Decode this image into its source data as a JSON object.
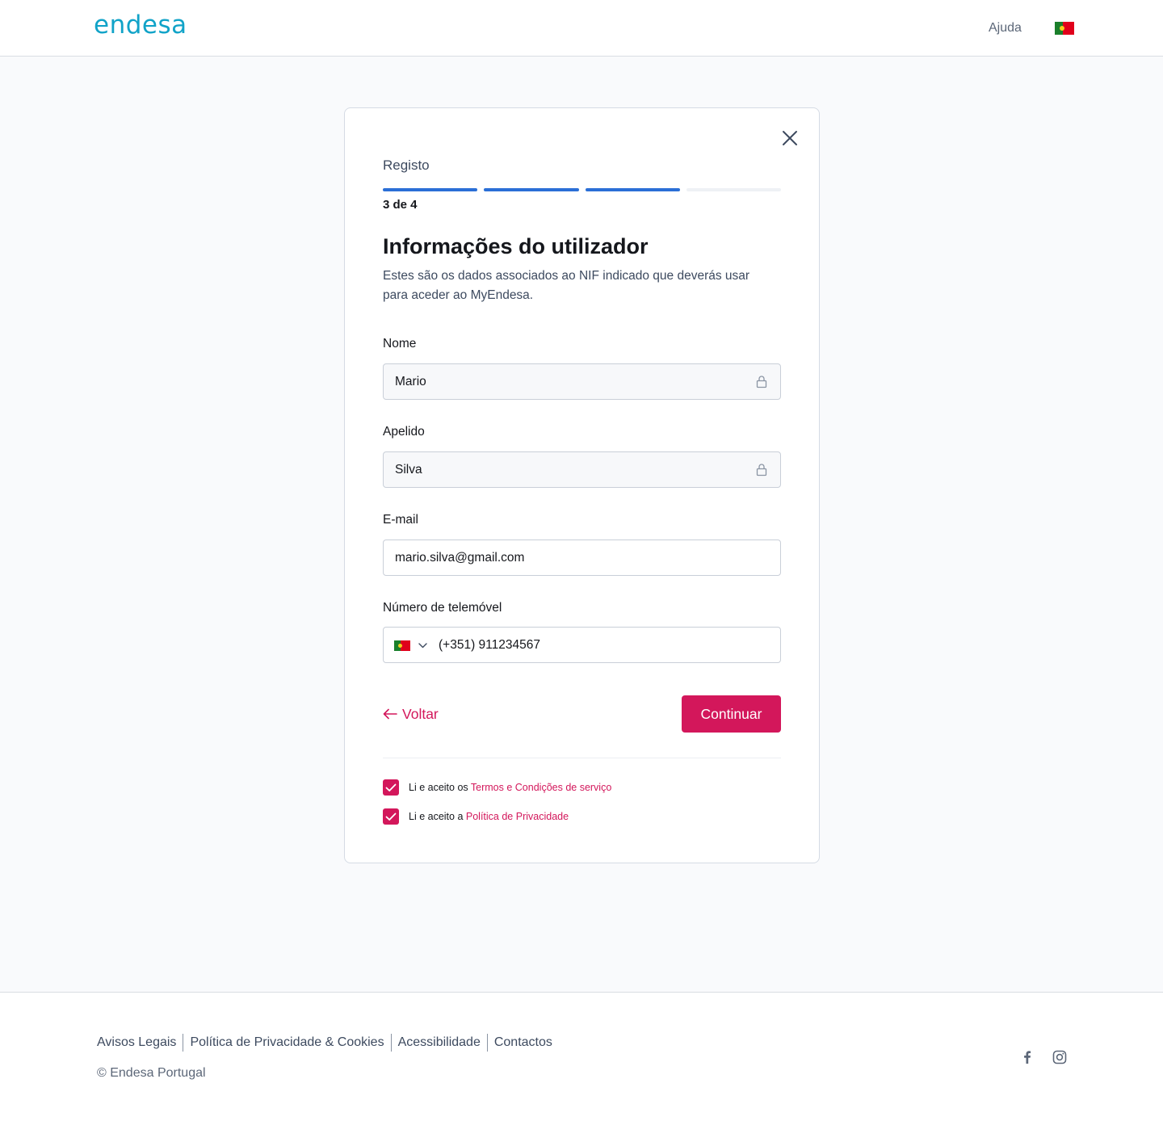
{
  "header": {
    "logo_text": "endesa",
    "help_label": "Ajuda",
    "language_flag": "portugal-flag"
  },
  "card": {
    "step_title": "Registo",
    "progress": {
      "current_step": 3,
      "total_steps": 4
    },
    "step_count": "3 de 4",
    "title": "Informações do utilizador",
    "description": "Estes são os dados associados ao NIF indicado que deverás usar para aceder ao MyEndesa.",
    "fields": {
      "first_name": {
        "label": "Nome",
        "value": "Mario",
        "locked": true
      },
      "last_name": {
        "label": "Apelido",
        "value": "Silva",
        "locked": true
      },
      "email": {
        "label": "E-mail",
        "value": "mario.silva@gmail.com"
      },
      "phone": {
        "label": "Número de telemóvel",
        "value": "(+351) 911234567",
        "country_flag": "portugal-flag"
      }
    },
    "back_label": "Voltar",
    "continue_label": "Continuar",
    "terms": {
      "prefix": "Li e aceito os ",
      "link": "Termos e Condições de serviço",
      "checked": true
    },
    "privacy": {
      "prefix": "Li e aceito a ",
      "link": "Política de Privacidade",
      "checked": true
    }
  },
  "footer": {
    "links": [
      "Avisos Legais",
      "Política de Privacidade & Cookies",
      "Acessibilidade",
      "Contactos"
    ],
    "copyright": "© Endesa Portugal",
    "social": [
      "facebook-icon",
      "instagram-icon"
    ]
  },
  "colors": {
    "brand_pink": "#d3175b",
    "progress_blue": "#2b6fd6",
    "logo_cyan": "#11a3c8",
    "page_background": "#f9fafc"
  }
}
